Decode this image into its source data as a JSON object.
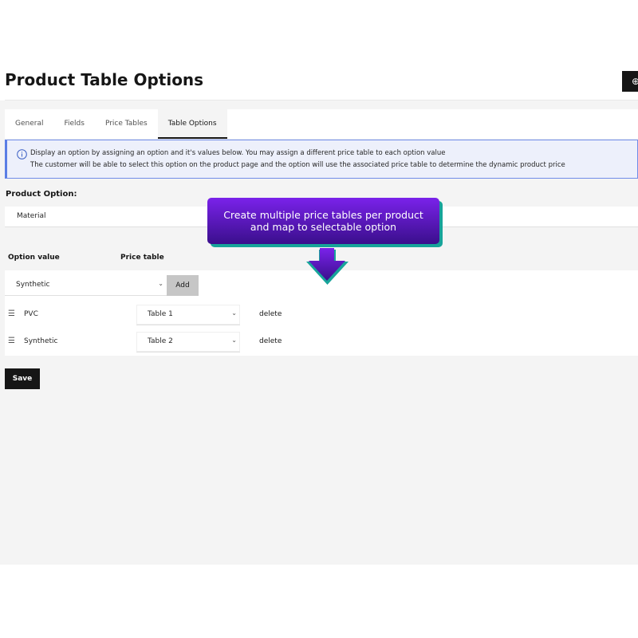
{
  "page": {
    "title": "Product Table Options"
  },
  "header": {
    "action_icon": "plus-circle-icon"
  },
  "tabs": [
    {
      "label": "General",
      "active": false
    },
    {
      "label": "Fields",
      "active": false
    },
    {
      "label": "Price Tables",
      "active": false
    },
    {
      "label": "Table Options",
      "active": true
    }
  ],
  "notice": {
    "icon": "info-icon",
    "line1": "Display an option by assigning an option and it's values below. You may assign a different price table to each option value",
    "line2": "The customer will be able to select this option on the product page and the option will use the associated price table to determine the dynamic product price"
  },
  "product_option": {
    "label": "Product Option:",
    "value": "Material"
  },
  "options_table": {
    "headers": {
      "option_value": "Option value",
      "price_table": "Price table"
    },
    "new_row": {
      "selected": "Synthetic",
      "add_label": "Add"
    },
    "rows": [
      {
        "option": "PVC",
        "table": "Table 1",
        "delete_label": "delete"
      },
      {
        "option": "Synthetic",
        "table": "Table 2",
        "delete_label": "delete"
      }
    ]
  },
  "save_label": "Save",
  "callout": {
    "line1": "Create multiple price tables per product",
    "line2": "and map to selectable option",
    "colors": {
      "top": "#7a22ea",
      "bottom": "#3a0f8c",
      "shadow": "#17a49a"
    }
  },
  "colors": {
    "primary_dark": "#161616",
    "notice_border": "#5b7ee5",
    "notice_bg": "#edf0fb"
  }
}
